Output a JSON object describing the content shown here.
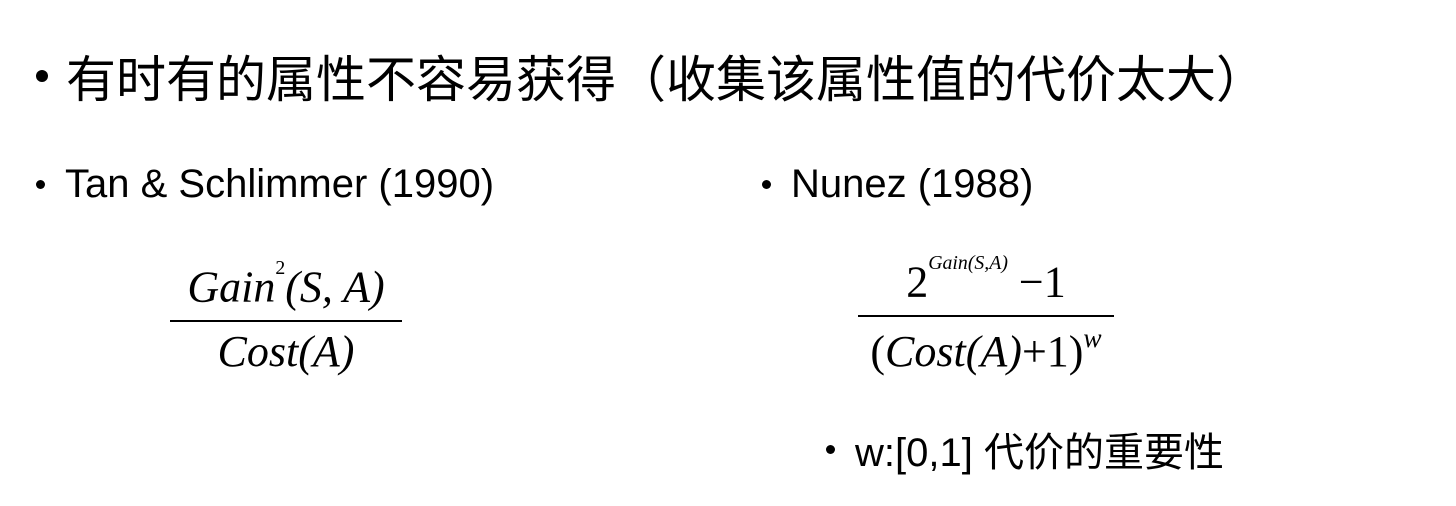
{
  "main_bullet": "有时有的属性不容易获得（收集该属性值的代价太大）",
  "left": {
    "heading": "Tan & Schlimmer (1990)",
    "formula": {
      "num_fn": "Gain",
      "num_exp": "2",
      "num_args": "(S, A)",
      "den_fn": "Cost",
      "den_args": "(A)"
    }
  },
  "right": {
    "heading": "Nunez (1988)",
    "formula": {
      "num_base": "2",
      "num_exp": "Gain(S,A)",
      "num_tail": " −1",
      "den_open": "(",
      "den_fn": "Cost",
      "den_args": "(A)",
      "den_tail": "+1)",
      "den_exp": "w"
    },
    "note": "w:[0,1] 代价的重要性"
  }
}
